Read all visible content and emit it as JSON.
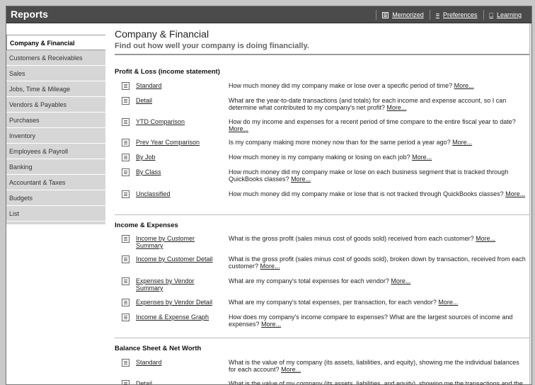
{
  "window": {
    "title": "Reports"
  },
  "toolbar": {
    "memorized": "Memorized",
    "preferences": "Preferences",
    "learning": "Learning"
  },
  "sidebar": {
    "items": [
      {
        "label": "Company & Financial",
        "active": true
      },
      {
        "label": "Customers & Receivables"
      },
      {
        "label": "Sales"
      },
      {
        "label": "Jobs, Time & Mileage"
      },
      {
        "label": "Vendors & Payables"
      },
      {
        "label": "Purchases"
      },
      {
        "label": "Inventory"
      },
      {
        "label": "Employees & Payroll"
      },
      {
        "label": "Banking"
      },
      {
        "label": "Accountant & Taxes"
      },
      {
        "label": "Budgets"
      },
      {
        "label": "List"
      }
    ]
  },
  "main": {
    "title": "Company & Financial",
    "subtitle": "Find out how well your company is doing financially.",
    "more_label": "More...",
    "sections": [
      {
        "heading": "Profit & Loss (income statement)",
        "reports": [
          {
            "name": "Standard",
            "desc": "How much money did my company make or lose over a specific period of time?"
          },
          {
            "name": "Detail",
            "desc": "What are the year-to-date transactions (and totals) for each income and expense account, so I can determine what contributed to my company's net profit?"
          },
          {
            "name": "YTD Comparison",
            "desc": "How do my income and expenses for a recent period of time compare to the entire fiscal year to date?"
          },
          {
            "name": "Prev Year Comparison",
            "desc": "Is my company making more money now than for the same period a year ago?"
          },
          {
            "name": "By Job",
            "desc": "How much money is my company making or losing on each job?"
          },
          {
            "name": "By Class",
            "desc": "How much money did my company make or lose on each business segment that is tracked through QuickBooks classes?"
          },
          {
            "name": "Unclassified",
            "desc": "How much money did my company make or lose that is not tracked through QuickBooks classes?"
          }
        ]
      },
      {
        "heading": "Income & Expenses",
        "reports": [
          {
            "name": "Income by Customer Summary",
            "desc": "What is the gross profit (sales minus cost of goods sold) received from each customer?"
          },
          {
            "name": "Income by Customer Detail",
            "desc": "What is the gross profit (sales minus cost of goods sold), broken down by transaction, received from each customer?"
          },
          {
            "name": "Expenses by Vendor Summary",
            "desc": "What are my company's total expenses for each vendor?"
          },
          {
            "name": "Expenses by Vendor Detail",
            "desc": "What are my company's total expenses, per transaction, for each vendor?"
          },
          {
            "name": "Income & Expense Graph",
            "desc": "How does my company's income compare to expenses? What are the largest sources of income and expenses?"
          }
        ]
      },
      {
        "heading": "Balance Sheet & Net Worth",
        "reports": [
          {
            "name": "Standard",
            "desc": "What is the value of my company (its assets, liabilities, and equity), showing me the individual balances for each account?"
          },
          {
            "name": "Detail",
            "desc": "What is the value of my company (its assets, liabilities, and equity), showing me the transactions and the starting and ending balance for each account?"
          }
        ]
      }
    ]
  }
}
